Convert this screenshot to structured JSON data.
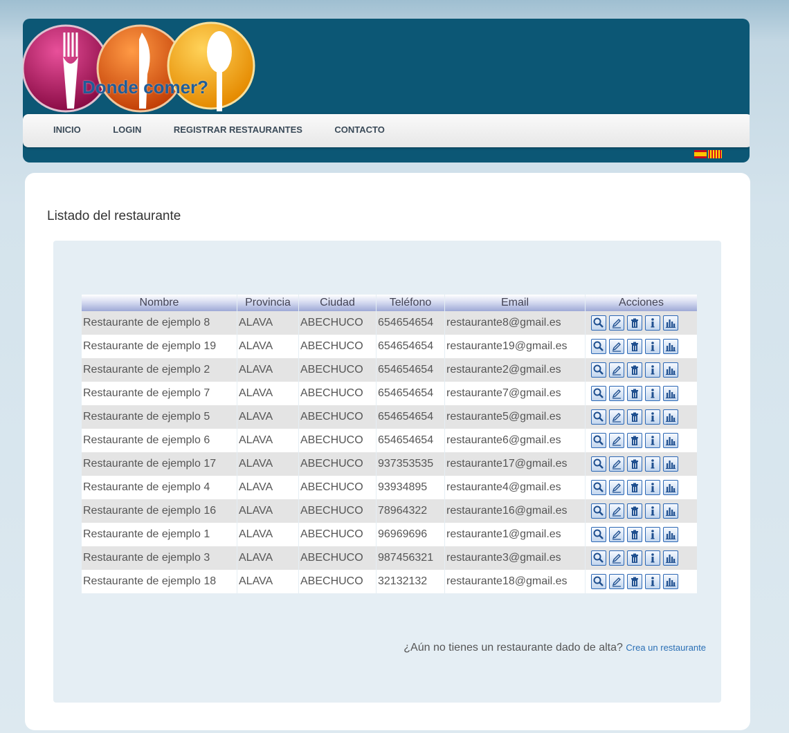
{
  "site": {
    "title": "Donde comer?"
  },
  "nav": {
    "items": [
      {
        "label": "INICIO"
      },
      {
        "label": "LOGIN"
      },
      {
        "label": "REGISTRAR RESTAURANTES"
      },
      {
        "label": "CONTACTO"
      }
    ]
  },
  "flags": [
    "spanish-flag-icon",
    "catalan-flag-icon"
  ],
  "page": {
    "title": "Listado del restaurante"
  },
  "table": {
    "headers": [
      "Nombre",
      "Provincia",
      "Ciudad",
      "Teléfono",
      "Email",
      "Acciones"
    ],
    "actions": [
      "view-icon",
      "edit-icon",
      "delete-icon",
      "info-icon",
      "stats-icon"
    ],
    "rows": [
      [
        "Restaurante de ejemplo 8",
        "ALAVA",
        "ABECHUCO",
        "654654654",
        "restaurante8@gmail.es"
      ],
      [
        "Restaurante de ejemplo 19",
        "ALAVA",
        "ABECHUCO",
        "654654654",
        "restaurante19@gmail.es"
      ],
      [
        "Restaurante de ejemplo 2",
        "ALAVA",
        "ABECHUCO",
        "654654654",
        "restaurante2@gmail.es"
      ],
      [
        "Restaurante de ejemplo 7",
        "ALAVA",
        "ABECHUCO",
        "654654654",
        "restaurante7@gmail.es"
      ],
      [
        "Restaurante de ejemplo 5",
        "ALAVA",
        "ABECHUCO",
        "654654654",
        "restaurante5@gmail.es"
      ],
      [
        "Restaurante de ejemplo 6",
        "ALAVA",
        "ABECHUCO",
        "654654654",
        "restaurante6@gmail.es"
      ],
      [
        "Restaurante de ejemplo 17",
        "ALAVA",
        "ABECHUCO",
        "937353535",
        "restaurante17@gmail.es"
      ],
      [
        "Restaurante de ejemplo 4",
        "ALAVA",
        "ABECHUCO",
        "93934895",
        "restaurante4@gmail.es"
      ],
      [
        "Restaurante de ejemplo 16",
        "ALAVA",
        "ABECHUCO",
        "78964322",
        "restaurante16@gmail.es"
      ],
      [
        "Restaurante de ejemplo 1",
        "ALAVA",
        "ABECHUCO",
        "96969696",
        "restaurante1@gmail.es"
      ],
      [
        "Restaurante de ejemplo 3",
        "ALAVA",
        "ABECHUCO",
        "987456321",
        "restaurante3@gmail.es"
      ],
      [
        "Restaurante de ejemplo 18",
        "ALAVA",
        "ABECHUCO",
        "32132132",
        "restaurante18@gmail.es"
      ]
    ]
  },
  "footer": {
    "question": "¿Aún no tienes un restaurante dado de alta?",
    "link": "Crea un restaurante"
  }
}
